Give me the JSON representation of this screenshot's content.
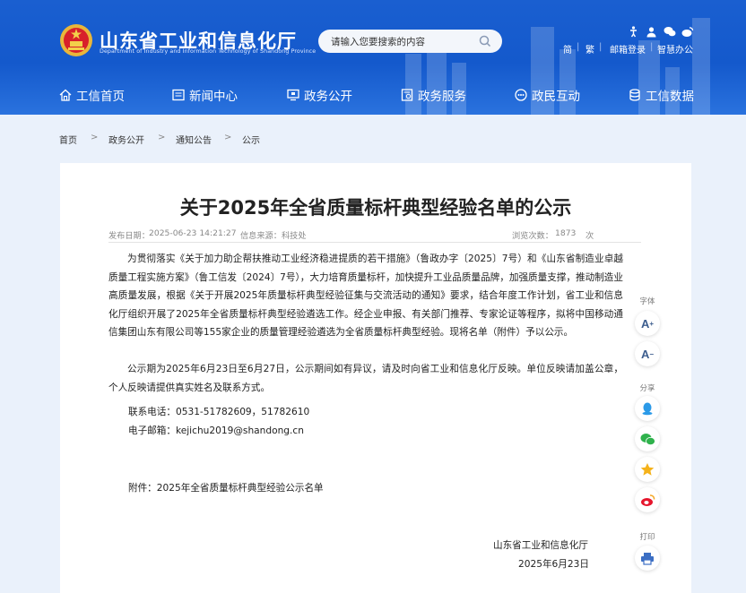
{
  "site": {
    "title": "山东省工业和信息化厅",
    "subtitle": "Department of Industry and Information Technology of Shandong Province"
  },
  "search": {
    "placeholder": "请输入您要搜索的内容"
  },
  "top_links": [
    "简",
    "繁",
    "邮箱登录",
    "智慧办公"
  ],
  "nav": [
    {
      "label": "工信首页",
      "icon": "home-icon"
    },
    {
      "label": "新闻中心",
      "icon": "news-icon"
    },
    {
      "label": "政务公开",
      "icon": "monitor-icon"
    },
    {
      "label": "政务服务",
      "icon": "service-icon"
    },
    {
      "label": "政民互动",
      "icon": "interaction-icon"
    },
    {
      "label": "工信数据",
      "icon": "database-icon"
    }
  ],
  "breadcrumb": [
    "首页",
    ">",
    "政务公开",
    ">",
    "通知公告",
    ">",
    "公示"
  ],
  "article": {
    "title": "关于2025年全省质量标杆典型经验名单的公示",
    "publish_date_label": "发布日期：",
    "publish_date": "2025-06-23 14:21:27",
    "source_label": "信息来源：",
    "source": "科技处",
    "views_label": "浏览次数：",
    "views": "1873",
    "views_unit": "次",
    "paragraph1": "为贯彻落实《关于加力助企帮扶推动工业经济稳进提质的若干措施》（鲁政办字〔2025〕7号）和《山东省制造业卓越质量工程实施方案》（鲁工信发〔2024〕7号），大力培育质量标杆，加快提升工业品质量品牌，加强质量支撑，推动制造业高质量发展，根据《关于开展2025年质量标杆典型经验征集与交流活动的通知》要求，结合年度工作计划，省工业和信息化厅组织开展了2025年全省质量标杆典型经验遴选工作。经企业申报、有关部门推荐、专家论证等程序，拟将中国移动通信集团山东有限公司等155家企业的质量管理经验遴选为全省质量标杆典型经验。现将名单（附件）予以公示。",
    "paragraph2": "公示期为2025年6月23日至6月27日，公示期间如有异议，请及时向省工业和信息化厅反映。单位反映请加盖公章，个人反映请提供真实姓名及联系方式。",
    "phone": "联系电话：0531-51782609，51782610",
    "email": "电子邮箱：kejichu2019@shandong.cn",
    "attachment": "附件：2025年全省质量标杆典型经验公示名单",
    "signature": "山东省工业和信息化厅",
    "sign_date": "2025年6月23日"
  },
  "sidebar": {
    "font_label": "字体",
    "font_increase": "A",
    "font_decrease": "A",
    "share_label": "分享",
    "share_items": [
      "qq-icon",
      "wechat-icon",
      "qzone-icon",
      "weibo-icon"
    ],
    "print_label": "打印"
  },
  "colors": {
    "header": "#1a5fd0",
    "background": "#eaf1fb",
    "accent": "#3c5d8e"
  }
}
